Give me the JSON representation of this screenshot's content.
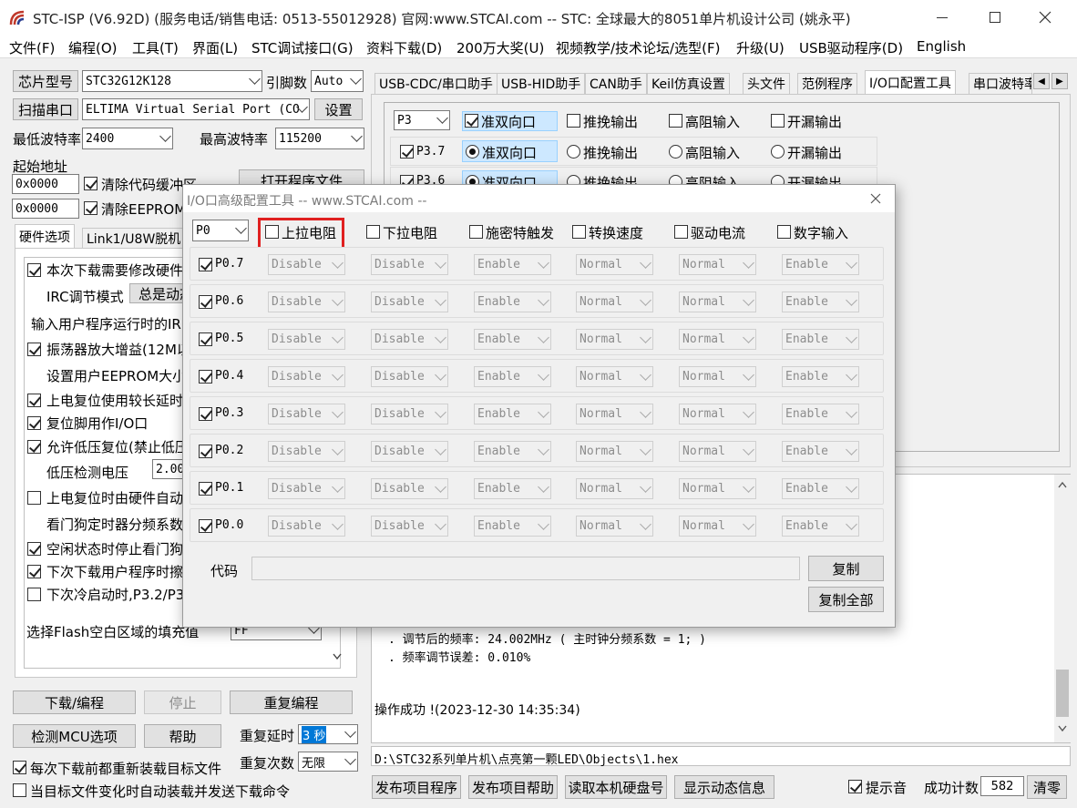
{
  "window": {
    "title": "STC-ISP (V6.92D) (服务电话/销售电话: 0513-55012928) 官网:www.STCAI.com  -- STC: 全球最大的8051单片机设计公司 (姚永平)"
  },
  "menu": [
    "文件(F)",
    "编程(O)",
    "工具(T)",
    "界面(L)",
    "STC调试接口(G)",
    "资料下载(D)",
    "200万大奖(U)",
    "视频教学/技术论坛/选型(F)",
    "升级(U)",
    "USB驱动程序(D)",
    "English"
  ],
  "left": {
    "chip_btn": "芯片型号",
    "chip_value": "STC32G12K128",
    "pin_label": "引脚数",
    "pin_value": "Auto",
    "scan_btn": "扫描串口",
    "port_value": "ELTIMA Virtual Serial Port (CO",
    "settings_btn": "设置",
    "min_baud_label": "最低波特率",
    "min_baud": "2400",
    "max_baud_label": "最高波特率",
    "max_baud": "115200",
    "start_addr_label": "起始地址",
    "addr1": "0x0000",
    "addr2": "0x0000",
    "clear_code": "清除代码缓冲区",
    "clear_eeprom": "清除EEPROM缓",
    "open_prog": "打开程序文件",
    "tabs": [
      "硬件选项",
      "Link1/U8W脱机"
    ],
    "options": [
      "本次下载需要修改硬件",
      "IRC调节模式",
      "总是动态",
      "输入用户程序运行时的IR",
      "振荡器放大增益(12M以",
      "设置用户EEPROM大小",
      "上电复位使用较长延时",
      "复位脚用作I/O口",
      "允许低压复位(禁止低压",
      "低压检测电压",
      "2.00",
      "上电复位时由硬件自动",
      "看门狗定时器分频系数",
      "空闲状态时停止看门狗",
      "下次下载用户程序时擦",
      "下次冷启动时,P3.2/P3",
      "选择Flash空白区域的填充值",
      "FF"
    ],
    "download_btn": "下载/编程",
    "stop_btn": "停止",
    "reprog_btn": "重复编程",
    "detect_btn": "检测MCU选项",
    "help_btn": "帮助",
    "repeat_delay_label": "重复延时",
    "repeat_delay": "3 秒",
    "repeat_count_label": "重复次数",
    "repeat_count": "无限",
    "reload_chk": "每次下载前都重新装载目标文件",
    "auto_chk": "当目标文件变化时自动装载并发送下载命令"
  },
  "right": {
    "tabs": [
      "USB-CDC/串口助手",
      "USB-HID助手",
      "CAN助手",
      "Keil仿真设置",
      "头文件",
      "范例程序",
      "I/O口配置工具",
      "串口波特率"
    ],
    "port_select": "P3",
    "mode_header": [
      "准双向口",
      "推挽输出",
      "高阻输入",
      "开漏输出"
    ],
    "pins": [
      "P3.7",
      "P3.6"
    ],
    "log": [
      ". 调节后的频率: 24.002MHz ( 主时钟分频系数 = 1; )",
      ". 频率调节误差: 0.010%",
      "操作成功 !(2023-12-30 14:35:34)"
    ],
    "path": "D:\\STC32系列单片机\\点亮第一颗LED\\Objects\\1.hex",
    "publish_prog": "发布项目程序",
    "publish_help": "发布项目帮助",
    "read_disk": "读取本机硬盘号",
    "show_dyn": "显示动态信息",
    "beep": "提示音",
    "success_label": "成功计数",
    "success_count": "582",
    "clear_btn": "清零"
  },
  "dialog": {
    "title": "I/O口高级配置工具 -- www.STCAI.com --",
    "port": "P0",
    "headers": [
      "上拉电阻",
      "下拉电阻",
      "施密特触发",
      "转换速度",
      "驱动电流",
      "数字输入"
    ],
    "pins": [
      "P0.7",
      "P0.6",
      "P0.5",
      "P0.4",
      "P0.3",
      "P0.2",
      "P0.1",
      "P0.0"
    ],
    "values": [
      "Disable",
      "Disable",
      "Enable",
      "Normal",
      "Normal",
      "Enable"
    ],
    "code_label": "代码",
    "copy_btn": "复制",
    "copy_all_btn": "复制全部"
  },
  "colors": {
    "highlight_box": "#e02020",
    "selection": "#cde8ff"
  }
}
